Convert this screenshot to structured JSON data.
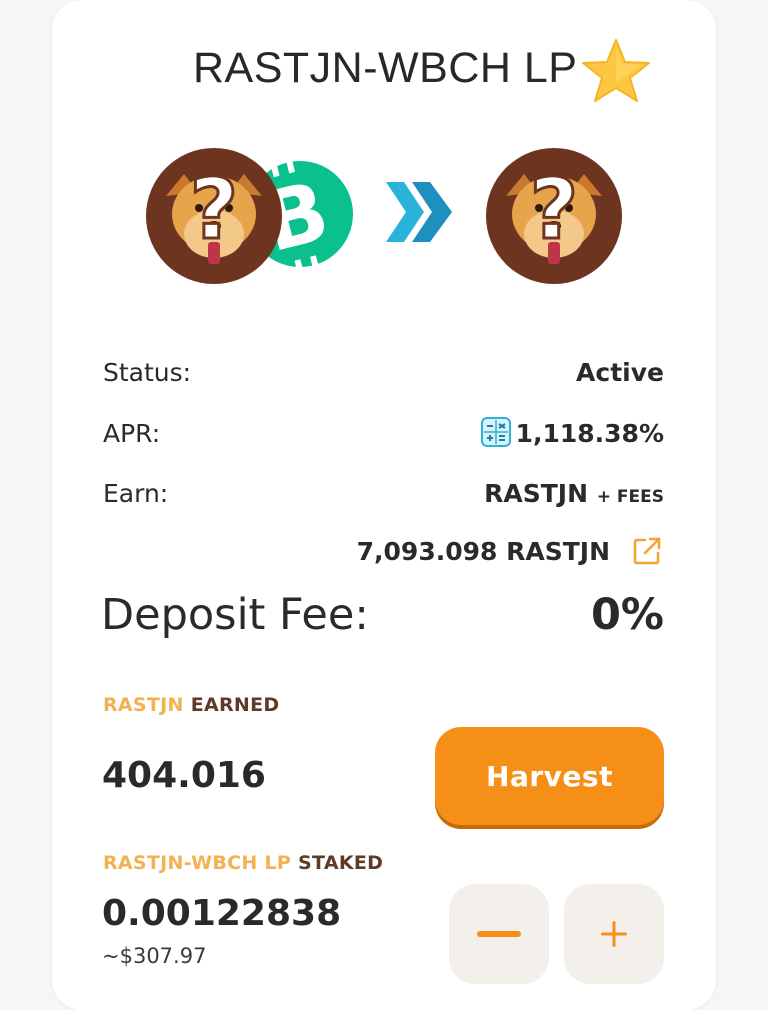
{
  "pool": {
    "title": "RASTJN-WBCH LP",
    "favorite_icon": "star-icon",
    "tokens": [
      "dog-question-token-icon",
      "bitcoin-cash-icon",
      "dog-question-token-icon"
    ]
  },
  "details": {
    "status_label": "Status:",
    "status_value": "Active",
    "apr_label": "APR:",
    "apr_value": "1,118.38%",
    "earn_label": "Earn:",
    "earn_token": "RASTJN",
    "earn_suffix": "+ FEES",
    "total_rewards": "7,093.098 RASTJN",
    "deposit_fee_label": "Deposit Fee:",
    "deposit_fee_value": "0%"
  },
  "earned": {
    "label_token": "RASTJN",
    "label_rest": "EARNED",
    "amount": "404.016",
    "harvest_label": "Harvest"
  },
  "staked": {
    "label_token": "RASTJN-WBCH LP",
    "label_rest": "STAKED",
    "amount": "0.00122838",
    "usd_value": "~$307.97"
  },
  "colors": {
    "accent": "#f3b14f",
    "harvest": "#f68f18",
    "bch_green": "#0ac18e",
    "arrow_blue": "#2ab3d8"
  }
}
